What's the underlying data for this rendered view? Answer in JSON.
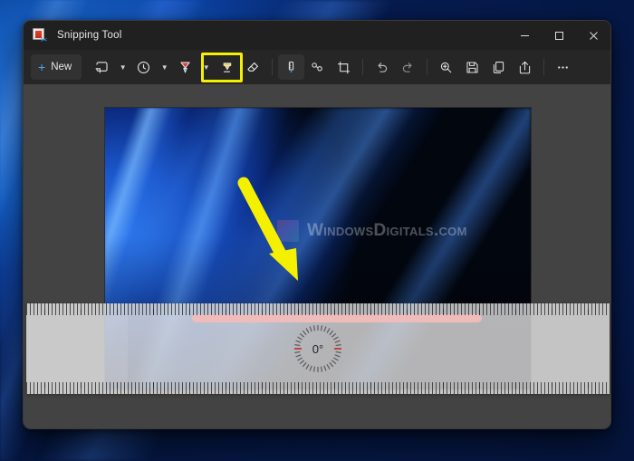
{
  "window": {
    "title": "Snipping Tool",
    "app_icon": "snipping-tool-icon",
    "controls": {
      "minimize": "Minimize",
      "maximize": "Maximize",
      "close": "Close"
    }
  },
  "toolbar": {
    "new_label": "New",
    "items": [
      {
        "name": "snipping-mode",
        "icon": "rectangle-snip-icon",
        "has_caret": true,
        "active": false
      },
      {
        "name": "delay-timer",
        "icon": "clock-icon",
        "has_caret": true,
        "active": false
      },
      {
        "name": "ballpoint-pen",
        "icon": "pen-icon",
        "has_caret": true,
        "active": true
      },
      {
        "name": "highlighter",
        "icon": "highlighter-icon",
        "has_caret": false,
        "active": false
      },
      {
        "name": "eraser",
        "icon": "eraser-icon",
        "has_caret": false,
        "active": false
      },
      {
        "name": "ruler",
        "icon": "ruler-icon",
        "has_caret": true,
        "active": false
      },
      {
        "name": "shapes",
        "icon": "shapes-icon",
        "has_caret": false,
        "active": false
      },
      {
        "name": "crop",
        "icon": "crop-icon",
        "has_caret": false,
        "active": false
      },
      {
        "name": "undo",
        "icon": "undo-icon",
        "has_caret": false,
        "active": false
      },
      {
        "name": "redo",
        "icon": "redo-icon",
        "has_caret": false,
        "active": false
      },
      {
        "name": "zoom",
        "icon": "magnifier-icon",
        "has_caret": false,
        "active": false
      },
      {
        "name": "save",
        "icon": "save-disk-icon",
        "has_caret": false,
        "active": false
      },
      {
        "name": "copy",
        "icon": "copy-icon",
        "has_caret": false,
        "active": false
      },
      {
        "name": "share",
        "icon": "share-icon",
        "has_caret": false,
        "active": false
      },
      {
        "name": "more-options",
        "icon": "ellipsis-icon",
        "has_caret": false,
        "active": false
      }
    ],
    "highlight_color": "#f5f000",
    "highlighted_tool": "ballpoint-pen"
  },
  "canvas": {
    "watermark": {
      "text": "WindowsDigitals.com",
      "logo": "watermark-logo"
    },
    "annotations": [
      {
        "name": "yellow-arrow",
        "type": "arrow",
        "color": "#f5f000"
      },
      {
        "name": "red-line",
        "type": "line",
        "color": "#f42222"
      }
    ]
  },
  "ruler_overlay": {
    "name": "ruler-overlay",
    "angle": "0°",
    "tick_color": "#2f2f2f",
    "surface_color": "#ececec"
  }
}
